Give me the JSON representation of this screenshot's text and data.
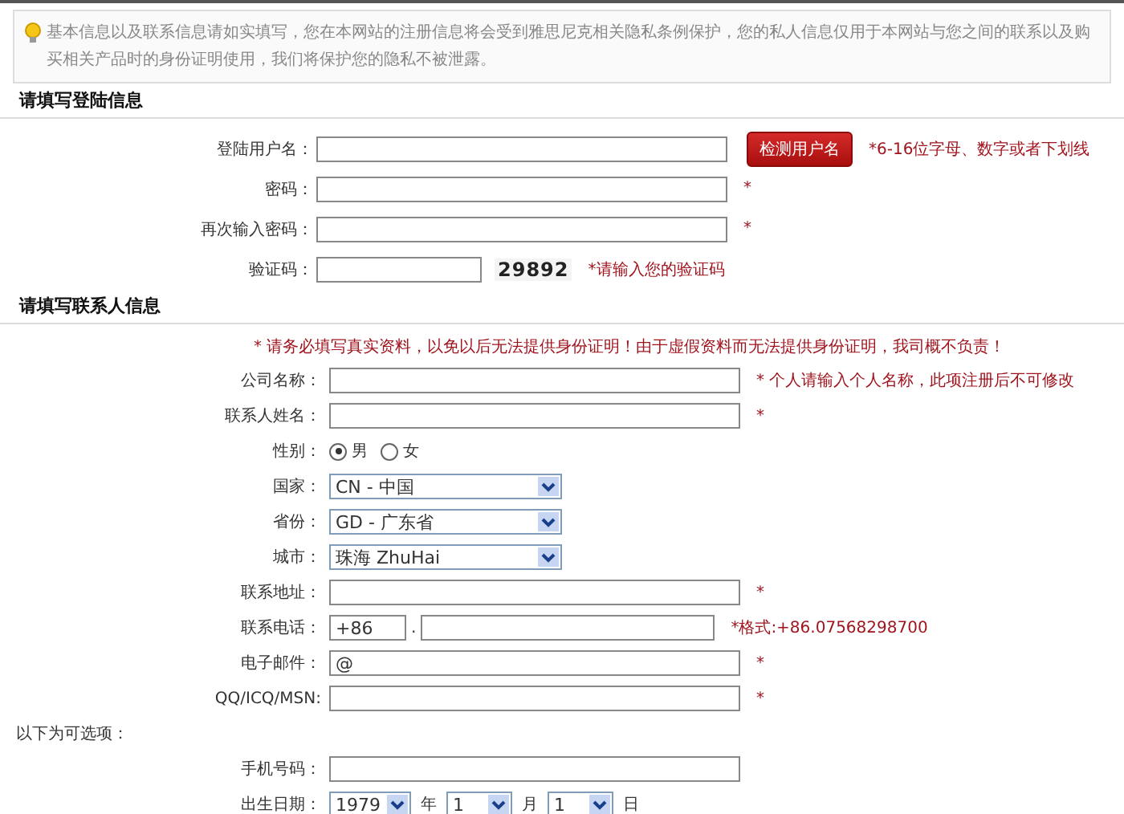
{
  "notice": "基本信息以及联系信息请如实填写，您在本网站的注册信息将会受到雅思尼克相关隐私条例保护，您的私人信息仅用于本网站与您之间的联系以及购买相关产品时的身份证明使用，我们将保护您的隐私不被泄露。",
  "sections": [
    {
      "kind": "heading",
      "title": "请填写登陆信息",
      "rows": [
        {
          "kind": "text",
          "label": "登陆用户名：",
          "button": "检测用户名",
          "note": "*6-16位字母、数字或者下划线"
        },
        {
          "kind": "password",
          "label": "密码：",
          "note": "*"
        },
        {
          "kind": "password",
          "label": "再次输入密码：",
          "note": "*"
        },
        {
          "kind": "captcha",
          "label": "验证码：",
          "code": "29892",
          "note": "*请输入您的验证码"
        }
      ]
    },
    {
      "kind": "heading",
      "title": "请填写联系人信息",
      "warning": "* 请务必填写真实资料，以免以后无法提供身份证明！由于虚假资料而无法提供身份证明，我司概不负责！",
      "rows": [
        {
          "kind": "text",
          "label": "公司名称：",
          "note": "* 个人请输入个人名称，此项注册后不可修改"
        },
        {
          "kind": "text",
          "label": "联系人姓名：",
          "note": "*"
        },
        {
          "kind": "radio",
          "label": "性别：",
          "options": [
            {
              "label": "男",
              "selected": true
            },
            {
              "label": "女",
              "selected": false
            }
          ]
        },
        {
          "kind": "select",
          "label": "国家：",
          "value": "CN - 中国"
        },
        {
          "kind": "select",
          "label": "省份：",
          "value": "GD - 广东省"
        },
        {
          "kind": "select",
          "label": "城市：",
          "value": "珠海 ZhuHai"
        },
        {
          "kind": "text",
          "label": "联系地址：",
          "note": "*"
        },
        {
          "kind": "phone",
          "label": "联系电话：",
          "prefix": "+86",
          "separator": ".",
          "note": "*格式:+86.07568298700"
        },
        {
          "kind": "text",
          "label": "电子邮件：",
          "value": "@",
          "note": "*"
        },
        {
          "kind": "text",
          "label": "QQ/ICQ/MSN:",
          "note": "*"
        }
      ]
    },
    {
      "kind": "plain",
      "title": "以下为可选项：",
      "rows": [
        {
          "kind": "text",
          "label": "手机号码："
        },
        {
          "kind": "date",
          "label": "出生日期：",
          "parts": [
            {
              "value": "1979",
              "unit": "年"
            },
            {
              "value": "1",
              "unit": "月"
            },
            {
              "value": "1",
              "unit": "日"
            }
          ]
        }
      ]
    }
  ]
}
